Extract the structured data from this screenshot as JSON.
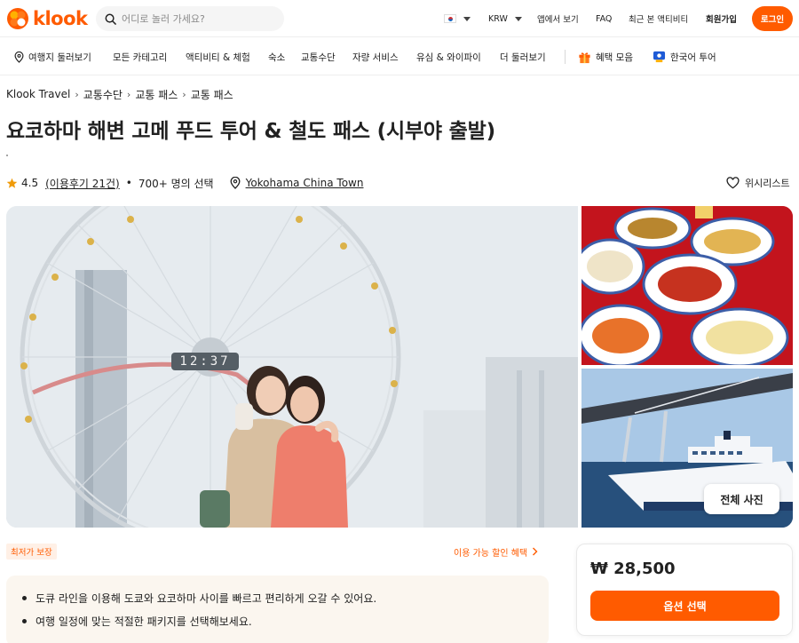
{
  "header": {
    "logo_text": "klook",
    "search_placeholder": "어디로 놀러 가세요?",
    "currency": "KRW",
    "app_link": "앱에서 보기",
    "faq": "FAQ",
    "recent": "최근 본 액티비티",
    "signup": "회원가입",
    "login": "로그인"
  },
  "nav": {
    "items": [
      "여행지 둘러보기",
      "모든 카테고리",
      "액티비티 & 체험",
      "숙소",
      "교통수단",
      "자량 서비스",
      "유심 & 와이파이",
      "더 둘러보기"
    ],
    "benefits": "혜택 모음",
    "korean_tour": "한국어 투어"
  },
  "breadcrumb": [
    "Klook Travel",
    "교통수단",
    "교통 패스",
    "교통 패스"
  ],
  "product": {
    "title": "요코하마 해변 고메 푸드 투어 & 철도 패스 (시부야 출발)",
    "rating": "4.5",
    "reviews": "(이용후기 21건)",
    "bullet": "•",
    "booked": "700+ 명의 선택",
    "location": "Yokohama China Town",
    "wishlist": "위시리스트"
  },
  "gallery": {
    "clock_text": "12:37",
    "all_photos": "전체 사진"
  },
  "info": {
    "badge": "최저가 보장",
    "discount_link": "이용 가능 할인 혜택",
    "highlights": [
      "도큐 라인을 이용해 도쿄와 요코하마 사이를 빠르고 편리하게 오갈 수 있어요.",
      "여행 일정에 맞는 적절한 패키지를 선택해보세요."
    ]
  },
  "booking": {
    "price": "₩ 28,500",
    "option_button": "옵션 선택"
  },
  "colors": {
    "brand": "#ff5b00",
    "star": "#f09b0a"
  }
}
